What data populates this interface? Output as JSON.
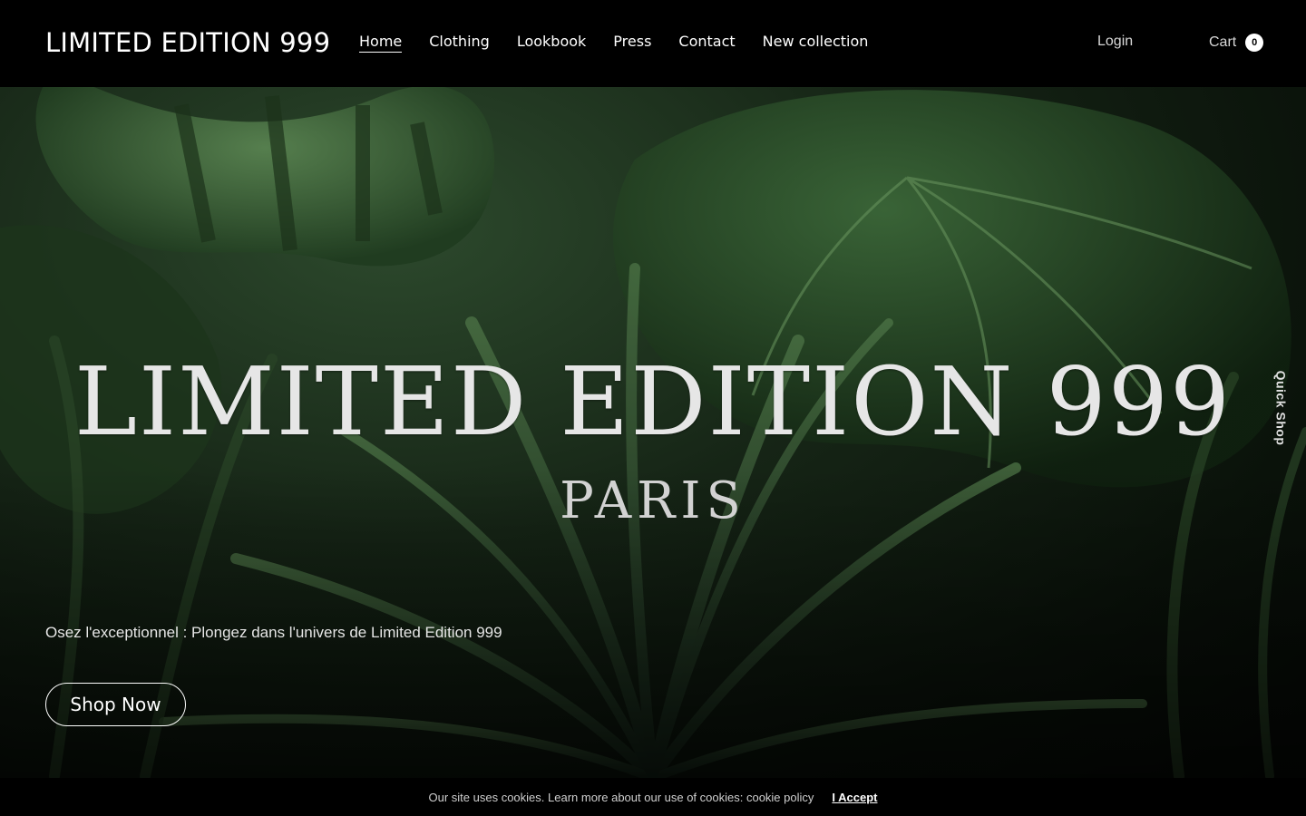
{
  "header": {
    "brand": "LIMITED EDITION 999",
    "nav": [
      {
        "label": "Home",
        "active": true
      },
      {
        "label": "Clothing"
      },
      {
        "label": "Lookbook"
      },
      {
        "label": "Press"
      },
      {
        "label": "Contact"
      },
      {
        "label": "New collection"
      }
    ],
    "login": "Login",
    "cart_label": "Cart",
    "cart_count": "0"
  },
  "hero": {
    "title": "LIMITED EDITION 999",
    "subtitle": "PARIS",
    "tagline": "Osez l'exceptionnel : Plongez dans l'univers de Limited Edition 999",
    "cta": "Shop Now",
    "background": "tropical-foliage-image",
    "quick_shop": "Quick Shop"
  },
  "cookie": {
    "text": "Our site uses cookies. Learn more about our use of cookies: cookie policy",
    "accept": "I Accept"
  },
  "colors": {
    "header_bg": "#000000",
    "foliage_dark": "#0a120a",
    "foliage_mid": "#2d4a2d",
    "text": "#ffffff"
  }
}
